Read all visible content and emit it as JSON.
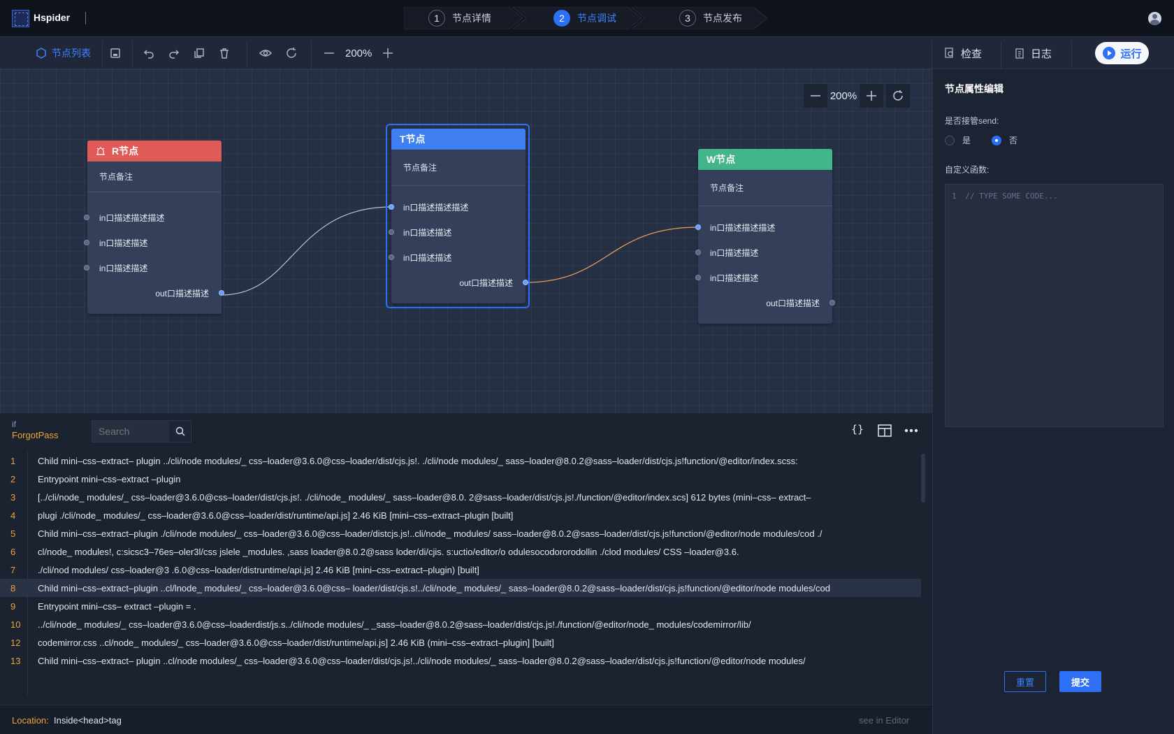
{
  "app": {
    "brand": "Hspider"
  },
  "steps": [
    {
      "num": "1",
      "label": "节点详情",
      "active": false
    },
    {
      "num": "2",
      "label": "节点调试",
      "active": true
    },
    {
      "num": "3",
      "label": "节点发布",
      "active": false
    }
  ],
  "toolbar": {
    "node_list": "节点列表",
    "zoom": "200%",
    "inspect": "检查",
    "log": "日志",
    "run": "运行"
  },
  "canvas": {
    "zoom": "200%",
    "nodes": [
      {
        "id": "R",
        "title": "R节点",
        "color": "#e05a58",
        "note": "节点备注",
        "inputs": [
          "in口描述描述描述",
          "in口描述描述",
          "in口描述描述"
        ],
        "output": "out口描述描述"
      },
      {
        "id": "T",
        "title": "T节点",
        "color": "#3f7ff0",
        "note": "节点备注",
        "inputs": [
          "in口描述描述描述",
          "in口描述描述",
          "in口描述描述"
        ],
        "output": "out口描述描述"
      },
      {
        "id": "W",
        "title": "W节点",
        "color": "#43b58a",
        "note": "节点备注",
        "inputs": [
          "in口描述描述描述",
          "in口描述描述",
          "in口描述描述"
        ],
        "output": "out口描述描述"
      }
    ]
  },
  "panel": {
    "title": "节点属性编辑",
    "send_label": "是否接管send:",
    "yes": "是",
    "no": "否",
    "selected": "否",
    "func_label": "自定义函数:",
    "code_line": "1",
    "code_placeholder": "// TYPE SOME CODE...",
    "reset": "重置",
    "submit": "提交"
  },
  "console": {
    "context_kw": "if",
    "context_name": "ForgotPass",
    "search_placeholder": "Search",
    "lines": [
      {
        "n": "1",
        "t": "Child mini–css–extract– plugin ../cli/node modules/_ css–loader@3.6.0@css–loader/dist/cjs.js!. ./cli/node modules/_ sass–loader@8.0.2@sass–loader/dist/cjs.js!function/@editor/index.scss:"
      },
      {
        "n": "2",
        "t": "Entrypoint mini–css–extract –plugin"
      },
      {
        "n": "3",
        "t": "[../cli/node_ modules/_ css–loader@3.6.0@css–loader/dist/cjs.js!. ./cli/node_ modules/_ sass–loader@8.0. 2@sass–loader/dist/cjs.js!./function/@editor/index.scs] 612 bytes (mini–css– extract–"
      },
      {
        "n": "4",
        "t": "plugi ./cli/node_ modules/_ css–loader@3.6.0@css–loader/dist/runtime/api.js] 2.46 KiB [mini–css–extract–plugin [built]"
      },
      {
        "n": "5",
        "t": "Child mini–css–extract–plugin ./cli/node modules/_ css–loader@3.6.0@css–loader/distcjs.js!..cli/node_ modules/ sass–loader@8.0.2@sass–loader/dist/cjs.js!function/@editor/node modules/cod ./"
      },
      {
        "n": "6",
        "t": "cl/node_ modules!, c:sicsc3–76es–oler3l/css jslele _modules. ,sass loader@8.0.2@sass loder/di/cjis. s:uctio/editor/o odulesocodororodollin ./clod modules/ CSS –loader@3.6."
      },
      {
        "n": "7",
        "t": "./cli/nod modules/ css–loader@3 .6.0@css–loader/distruntime/api.js] 2.46 KiB [mini–css–extract–plugin) [built]"
      },
      {
        "n": "8",
        "t": "Child mini–css–extract–plugin ..cl/lnode_ modules/_ css–loader@3.6.0@css– loader/dist/cjs.s!../cli/node_ modules/_ sass–loader@8.0.2@sass–loader/dist/cjs.js!function/@editor/node modules/cod"
      },
      {
        "n": "9",
        "t": "Entrypoint mini–css– extract –plugin = ."
      },
      {
        "n": "10",
        "t": "../cli/node_ modules/_ css–loader@3.6.0@css–loaderdist/js.s../cli/node modules/_ _sass–loader@8.0.2@sass–loader/dist/cjs.js!./function/@editor/node_ modules/codemirror/lib/"
      },
      {
        "n": "12",
        "t": "codemirror.css ..cl/node_ modules/_ css–loader@3.6.0@css–loader/dist/runtime/api.js] 2.46 KiB (mini–css–extract–plugin] [built]"
      },
      {
        "n": "13",
        "t": "Child mini–css–extract– plugin ..cl/node modules/_ css–loader@3.6.0@css–loader/dist/cjs.js!../cli/node modules/_ sass–loader@8.0.2@sass–loader/dist/cjs.js!function/@editor/node modules/"
      }
    ],
    "location_label": "Location:",
    "location_value": "Inside<head>tag",
    "see_in_editor": "see in Editor"
  }
}
